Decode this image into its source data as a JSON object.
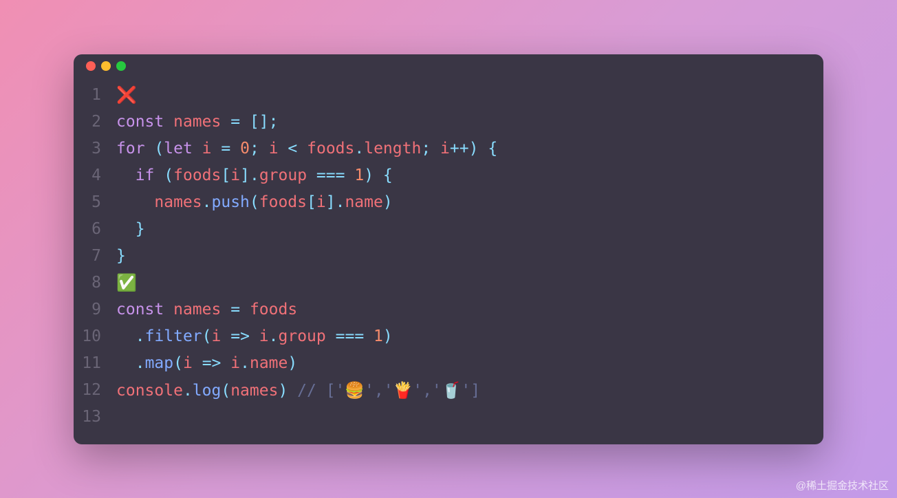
{
  "titlebar": {
    "dots": [
      "red",
      "yellow",
      "green"
    ]
  },
  "lines": [
    {
      "num": "1",
      "tokens": [
        {
          "cls": "emoji",
          "t": "❌"
        }
      ]
    },
    {
      "num": "2",
      "tokens": [
        {
          "cls": "kw",
          "t": "const"
        },
        {
          "cls": "",
          "t": " "
        },
        {
          "cls": "var",
          "t": "names"
        },
        {
          "cls": "",
          "t": " "
        },
        {
          "cls": "op",
          "t": "="
        },
        {
          "cls": "",
          "t": " "
        },
        {
          "cls": "punct",
          "t": "[]"
        },
        {
          "cls": "punct",
          "t": ";"
        }
      ]
    },
    {
      "num": "3",
      "tokens": [
        {
          "cls": "kw",
          "t": "for"
        },
        {
          "cls": "",
          "t": " "
        },
        {
          "cls": "punct",
          "t": "("
        },
        {
          "cls": "kw",
          "t": "let"
        },
        {
          "cls": "",
          "t": " "
        },
        {
          "cls": "var",
          "t": "i"
        },
        {
          "cls": "",
          "t": " "
        },
        {
          "cls": "op",
          "t": "="
        },
        {
          "cls": "",
          "t": " "
        },
        {
          "cls": "num",
          "t": "0"
        },
        {
          "cls": "punct",
          "t": ";"
        },
        {
          "cls": "",
          "t": " "
        },
        {
          "cls": "var",
          "t": "i"
        },
        {
          "cls": "",
          "t": " "
        },
        {
          "cls": "op",
          "t": "<"
        },
        {
          "cls": "",
          "t": " "
        },
        {
          "cls": "var",
          "t": "foods"
        },
        {
          "cls": "punct",
          "t": "."
        },
        {
          "cls": "prop",
          "t": "length"
        },
        {
          "cls": "punct",
          "t": ";"
        },
        {
          "cls": "",
          "t": " "
        },
        {
          "cls": "var",
          "t": "i"
        },
        {
          "cls": "op",
          "t": "++"
        },
        {
          "cls": "punct",
          "t": ")"
        },
        {
          "cls": "",
          "t": " "
        },
        {
          "cls": "punct",
          "t": "{"
        }
      ]
    },
    {
      "num": "4",
      "tokens": [
        {
          "cls": "",
          "t": "  "
        },
        {
          "cls": "kw",
          "t": "if"
        },
        {
          "cls": "",
          "t": " "
        },
        {
          "cls": "punct",
          "t": "("
        },
        {
          "cls": "var",
          "t": "foods"
        },
        {
          "cls": "punct",
          "t": "["
        },
        {
          "cls": "var",
          "t": "i"
        },
        {
          "cls": "punct",
          "t": "]"
        },
        {
          "cls": "punct",
          "t": "."
        },
        {
          "cls": "prop",
          "t": "group"
        },
        {
          "cls": "",
          "t": " "
        },
        {
          "cls": "op",
          "t": "==="
        },
        {
          "cls": "",
          "t": " "
        },
        {
          "cls": "num",
          "t": "1"
        },
        {
          "cls": "punct",
          "t": ")"
        },
        {
          "cls": "",
          "t": " "
        },
        {
          "cls": "punct",
          "t": "{"
        }
      ]
    },
    {
      "num": "5",
      "tokens": [
        {
          "cls": "",
          "t": "    "
        },
        {
          "cls": "var",
          "t": "names"
        },
        {
          "cls": "punct",
          "t": "."
        },
        {
          "cls": "fn",
          "t": "push"
        },
        {
          "cls": "punct",
          "t": "("
        },
        {
          "cls": "var",
          "t": "foods"
        },
        {
          "cls": "punct",
          "t": "["
        },
        {
          "cls": "var",
          "t": "i"
        },
        {
          "cls": "punct",
          "t": "]"
        },
        {
          "cls": "punct",
          "t": "."
        },
        {
          "cls": "prop",
          "t": "name"
        },
        {
          "cls": "punct",
          "t": ")"
        }
      ]
    },
    {
      "num": "6",
      "tokens": [
        {
          "cls": "",
          "t": "  "
        },
        {
          "cls": "punct",
          "t": "}"
        }
      ]
    },
    {
      "num": "7",
      "tokens": [
        {
          "cls": "punct",
          "t": "}"
        }
      ]
    },
    {
      "num": "8",
      "tokens": [
        {
          "cls": "emoji",
          "t": "✅"
        }
      ]
    },
    {
      "num": "9",
      "tokens": [
        {
          "cls": "kw",
          "t": "const"
        },
        {
          "cls": "",
          "t": " "
        },
        {
          "cls": "var",
          "t": "names"
        },
        {
          "cls": "",
          "t": " "
        },
        {
          "cls": "op",
          "t": "="
        },
        {
          "cls": "",
          "t": " "
        },
        {
          "cls": "var",
          "t": "foods"
        }
      ]
    },
    {
      "num": "10",
      "tokens": [
        {
          "cls": "",
          "t": "  "
        },
        {
          "cls": "punct",
          "t": "."
        },
        {
          "cls": "fn",
          "t": "filter"
        },
        {
          "cls": "punct",
          "t": "("
        },
        {
          "cls": "param",
          "t": "i"
        },
        {
          "cls": "",
          "t": " "
        },
        {
          "cls": "op",
          "t": "=>"
        },
        {
          "cls": "",
          "t": " "
        },
        {
          "cls": "var",
          "t": "i"
        },
        {
          "cls": "punct",
          "t": "."
        },
        {
          "cls": "prop",
          "t": "group"
        },
        {
          "cls": "",
          "t": " "
        },
        {
          "cls": "op",
          "t": "==="
        },
        {
          "cls": "",
          "t": " "
        },
        {
          "cls": "num",
          "t": "1"
        },
        {
          "cls": "punct",
          "t": ")"
        }
      ]
    },
    {
      "num": "11",
      "tokens": [
        {
          "cls": "",
          "t": "  "
        },
        {
          "cls": "punct",
          "t": "."
        },
        {
          "cls": "fn",
          "t": "map"
        },
        {
          "cls": "punct",
          "t": "("
        },
        {
          "cls": "param",
          "t": "i"
        },
        {
          "cls": "",
          "t": " "
        },
        {
          "cls": "op",
          "t": "=>"
        },
        {
          "cls": "",
          "t": " "
        },
        {
          "cls": "var",
          "t": "i"
        },
        {
          "cls": "punct",
          "t": "."
        },
        {
          "cls": "prop",
          "t": "name"
        },
        {
          "cls": "punct",
          "t": ")"
        }
      ]
    },
    {
      "num": "12",
      "tokens": [
        {
          "cls": "var",
          "t": "console"
        },
        {
          "cls": "punct",
          "t": "."
        },
        {
          "cls": "fn",
          "t": "log"
        },
        {
          "cls": "punct",
          "t": "("
        },
        {
          "cls": "var",
          "t": "names"
        },
        {
          "cls": "punct",
          "t": ")"
        },
        {
          "cls": "",
          "t": " "
        },
        {
          "cls": "comment",
          "t": "// ['🍔','🍟','🥤']"
        }
      ]
    },
    {
      "num": "13",
      "tokens": []
    }
  ],
  "watermark": "@稀土掘金技术社区"
}
